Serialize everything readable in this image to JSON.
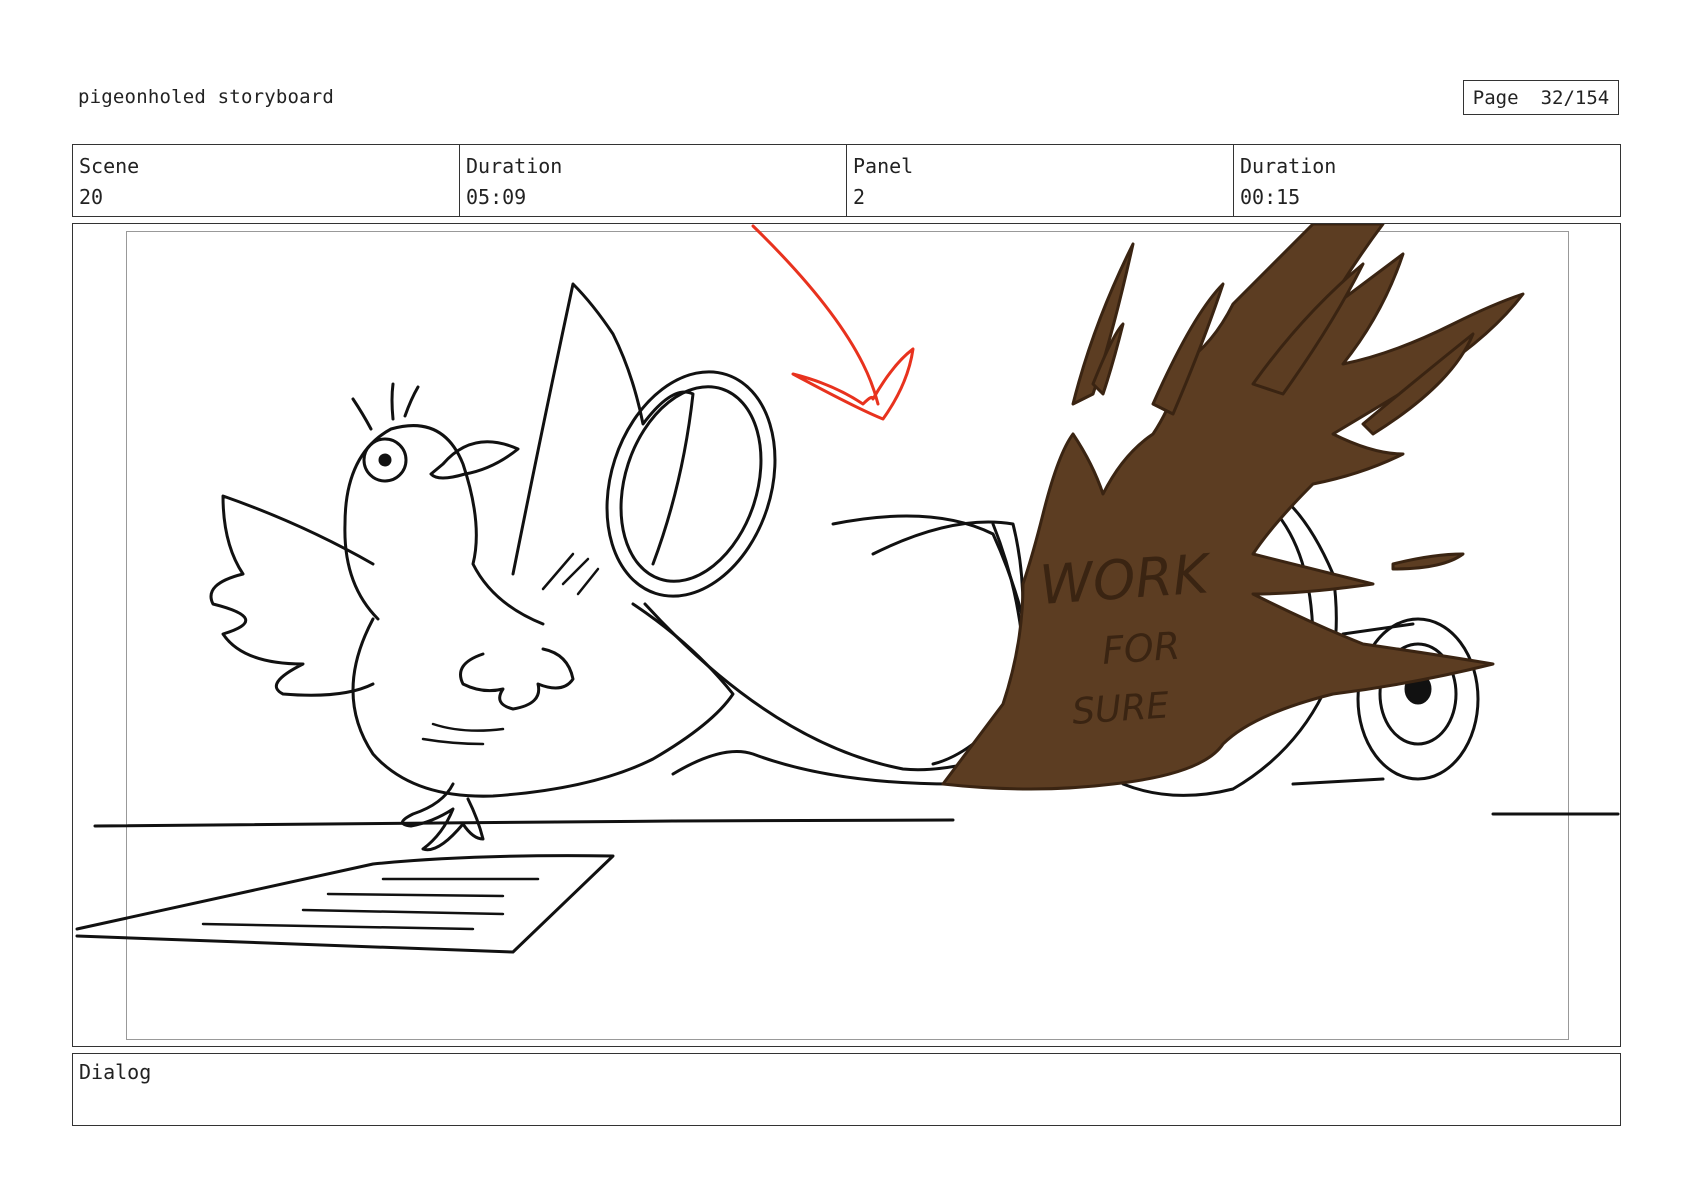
{
  "document": {
    "title": "pigeonholed storyboard",
    "page_label": "Page",
    "page_value": "32/154"
  },
  "info": [
    {
      "label": "Scene",
      "value": "20"
    },
    {
      "label": "Duration",
      "value": "05:09"
    },
    {
      "label": "Panel",
      "value": "2"
    },
    {
      "label": "Duration",
      "value": "00:15"
    }
  ],
  "panel": {
    "sign_lines": [
      "WORK",
      "FOR",
      "SURE"
    ],
    "colors": {
      "ink": "#111111",
      "arrow": "#e8321e",
      "splash": "#5c3d22",
      "splash_edge": "#3a2412",
      "frame": "#333333",
      "safe_frame": "#999999"
    }
  },
  "dialog": {
    "label": "Dialog",
    "text": ""
  }
}
